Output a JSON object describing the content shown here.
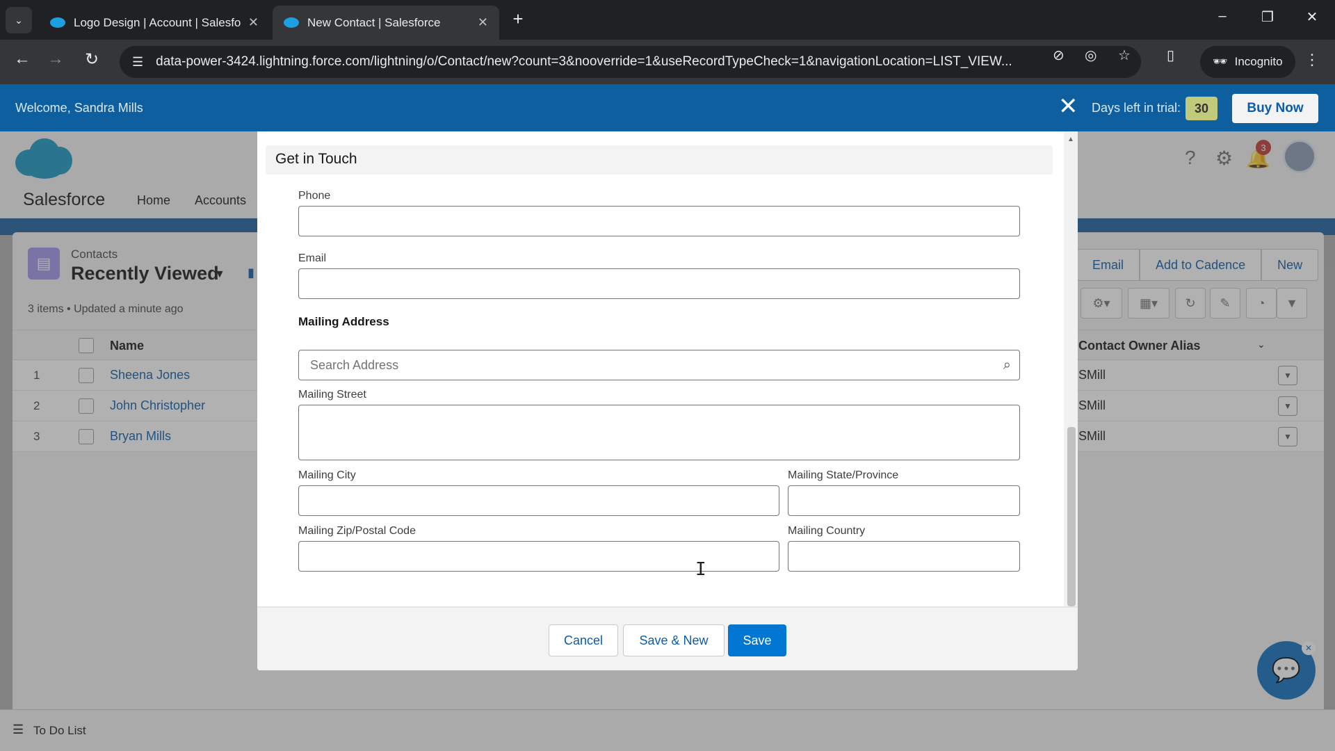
{
  "browser": {
    "tabs": [
      {
        "title": "Logo Design | Account | Salesfo",
        "active": false
      },
      {
        "title": "New Contact | Salesforce",
        "active": true
      }
    ],
    "url": "data-power-3424.lightning.force.com/lightning/o/Contact/new?count=3&nooverride=1&useRecordTypeCheck=1&navigationLocation=LIST_VIEW...",
    "incognito_label": "Incognito"
  },
  "trial_bar": {
    "welcome": "Welcome, Sandra Mills",
    "days_label": "Days left in trial:",
    "days_value": "30",
    "buy_label": "Buy Now"
  },
  "header": {
    "app_name": "Salesforce",
    "nav": [
      "Home",
      "Accounts"
    ],
    "notification_count": "3"
  },
  "list_view": {
    "object": "Contacts",
    "title": "Recently Viewed",
    "meta": "3 items • Updated a minute ago",
    "actions": [
      "Email",
      "Add to Cadence",
      "New"
    ],
    "columns": {
      "name": "Name",
      "owner": "Contact Owner Alias"
    },
    "rows": [
      {
        "num": "1",
        "name": "Sheena Jones",
        "alias": "SMill"
      },
      {
        "num": "2",
        "name": "John Christopher",
        "alias": "SMill"
      },
      {
        "num": "3",
        "name": "Bryan Mills",
        "alias": "SMill"
      }
    ]
  },
  "modal": {
    "section_title": "Get in Touch",
    "phone_label": "Phone",
    "email_label": "Email",
    "mailing_address_label": "Mailing Address",
    "search_placeholder": "Search Address",
    "street_label": "Mailing Street",
    "city_label": "Mailing City",
    "state_label": "Mailing State/Province",
    "zip_label": "Mailing Zip/Postal Code",
    "country_label": "Mailing Country",
    "buttons": {
      "cancel": "Cancel",
      "save_new": "Save & New",
      "save": "Save"
    }
  },
  "footer": {
    "todo_label": "To Do List"
  },
  "colors": {
    "brand": "#0176d3",
    "trial_bar": "#0e5fa0",
    "link": "#0b5cab"
  }
}
